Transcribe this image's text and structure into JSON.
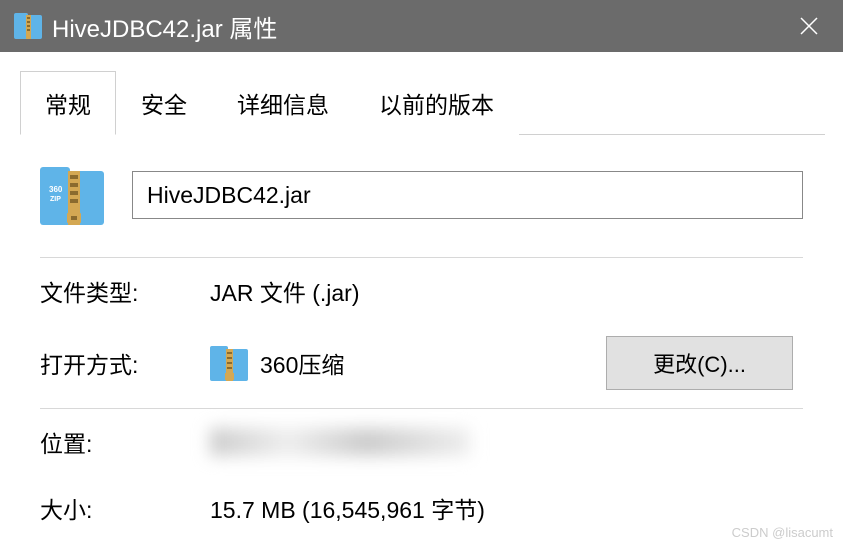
{
  "titlebar": {
    "title": "HiveJDBC42.jar 属性"
  },
  "tabs": {
    "general": "常规",
    "security": "安全",
    "details": "详细信息",
    "previous": "以前的版本"
  },
  "file": {
    "name": "HiveJDBC42.jar"
  },
  "fields": {
    "type_label": "文件类型:",
    "type_value": "JAR 文件 (.jar)",
    "open_with_label": "打开方式:",
    "open_with_value": "360压缩",
    "change_button": "更改(C)...",
    "location_label": "位置:",
    "size_label": "大小:",
    "size_value": "15.7 MB (16,545,961 字节)"
  },
  "watermark": "CSDN @lisacumt"
}
